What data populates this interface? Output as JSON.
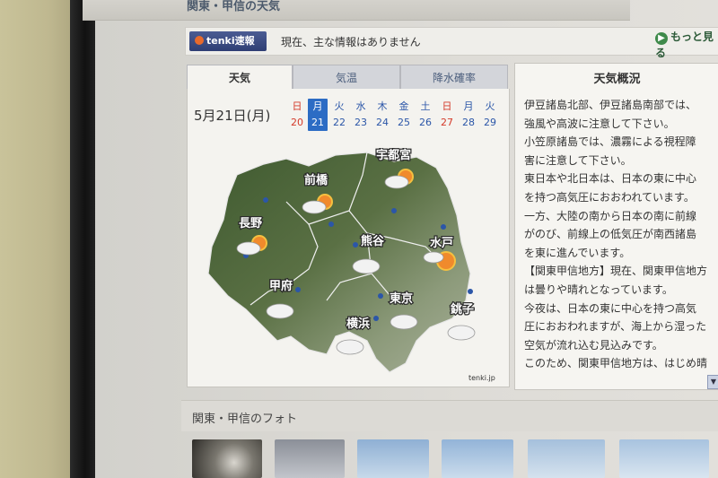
{
  "section_title": "関東・甲信の天気",
  "news": {
    "badge": "tenki速報",
    "text": "現在、主な情報はありません",
    "more_link": "もっと見る"
  },
  "tabs": [
    {
      "label": "天気",
      "active": true
    },
    {
      "label": "気温",
      "active": false
    },
    {
      "label": "降水確率",
      "active": false
    }
  ],
  "date_label": "5月21日(月)",
  "days": [
    {
      "weekday": "日",
      "day": "20",
      "color": "red"
    },
    {
      "weekday": "月",
      "day": "21",
      "color": "selected"
    },
    {
      "weekday": "火",
      "day": "22",
      "color": "blue"
    },
    {
      "weekday": "水",
      "day": "23",
      "color": "blue"
    },
    {
      "weekday": "木",
      "day": "24",
      "color": "blue"
    },
    {
      "weekday": "金",
      "day": "25",
      "color": "blue"
    },
    {
      "weekday": "土",
      "day": "26",
      "color": "blue"
    },
    {
      "weekday": "日",
      "day": "27",
      "color": "red"
    },
    {
      "weekday": "月",
      "day": "28",
      "color": "blue"
    },
    {
      "weekday": "火",
      "day": "29",
      "color": "blue"
    }
  ],
  "map": {
    "cities": [
      "宇都宮",
      "前橋",
      "長野",
      "熊谷",
      "水戸",
      "甲府",
      "東京",
      "横浜",
      "銚子"
    ],
    "credit": "tenki.jp"
  },
  "summary": {
    "title": "天気概況",
    "body": "伊豆諸島北部、伊豆諸島南部では、\n強風や高波に注意して下さい。\n小笠原諸島では、濃霧による視程障\n害に注意して下さい。\n東日本や北日本は、日本の東に中心\nを持つ高気圧におおわれています。\n一方、大陸の南から日本の南に前線\nがのび、前線上の低気圧が南西諸島\nを東に進んでいます。\n【関東甲信地方】現在、関東甲信地方\nは曇りや晴れとなっています。\n今夜は、日本の東に中心を持つ高気\n圧におおわれますが、海上から湿った\n空気が流れ込む見込みです。\nこのため、関東甲信地方は、はじめ晴"
  },
  "photo_section_title": "関東・甲信のフォト",
  "colors": {
    "accent": "#2c6cc4",
    "badge": "#34437a",
    "link": "#3f8a4b"
  }
}
